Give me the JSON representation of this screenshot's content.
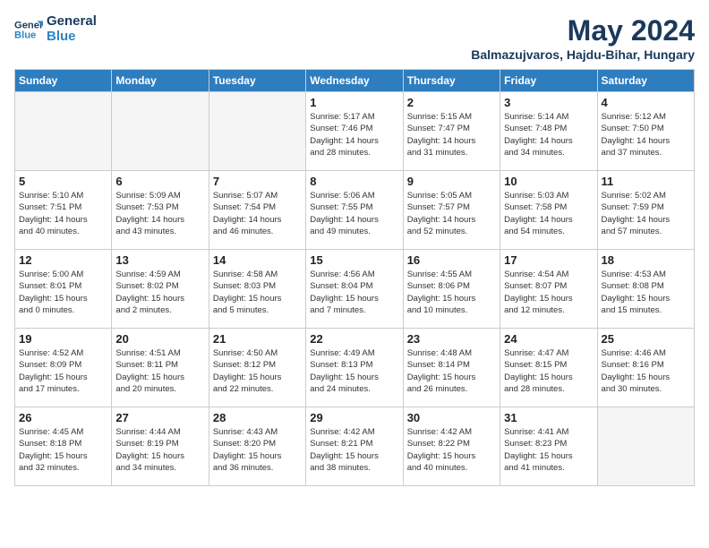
{
  "header": {
    "logo_line1": "General",
    "logo_line2": "Blue",
    "month_title": "May 2024",
    "subtitle": "Balmazujvaros, Hajdu-Bihar, Hungary"
  },
  "days_of_week": [
    "Sunday",
    "Monday",
    "Tuesday",
    "Wednesday",
    "Thursday",
    "Friday",
    "Saturday"
  ],
  "weeks": [
    [
      {
        "day": "",
        "info": ""
      },
      {
        "day": "",
        "info": ""
      },
      {
        "day": "",
        "info": ""
      },
      {
        "day": "1",
        "info": "Sunrise: 5:17 AM\nSunset: 7:46 PM\nDaylight: 14 hours\nand 28 minutes."
      },
      {
        "day": "2",
        "info": "Sunrise: 5:15 AM\nSunset: 7:47 PM\nDaylight: 14 hours\nand 31 minutes."
      },
      {
        "day": "3",
        "info": "Sunrise: 5:14 AM\nSunset: 7:48 PM\nDaylight: 14 hours\nand 34 minutes."
      },
      {
        "day": "4",
        "info": "Sunrise: 5:12 AM\nSunset: 7:50 PM\nDaylight: 14 hours\nand 37 minutes."
      }
    ],
    [
      {
        "day": "5",
        "info": "Sunrise: 5:10 AM\nSunset: 7:51 PM\nDaylight: 14 hours\nand 40 minutes."
      },
      {
        "day": "6",
        "info": "Sunrise: 5:09 AM\nSunset: 7:53 PM\nDaylight: 14 hours\nand 43 minutes."
      },
      {
        "day": "7",
        "info": "Sunrise: 5:07 AM\nSunset: 7:54 PM\nDaylight: 14 hours\nand 46 minutes."
      },
      {
        "day": "8",
        "info": "Sunrise: 5:06 AM\nSunset: 7:55 PM\nDaylight: 14 hours\nand 49 minutes."
      },
      {
        "day": "9",
        "info": "Sunrise: 5:05 AM\nSunset: 7:57 PM\nDaylight: 14 hours\nand 52 minutes."
      },
      {
        "day": "10",
        "info": "Sunrise: 5:03 AM\nSunset: 7:58 PM\nDaylight: 14 hours\nand 54 minutes."
      },
      {
        "day": "11",
        "info": "Sunrise: 5:02 AM\nSunset: 7:59 PM\nDaylight: 14 hours\nand 57 minutes."
      }
    ],
    [
      {
        "day": "12",
        "info": "Sunrise: 5:00 AM\nSunset: 8:01 PM\nDaylight: 15 hours\nand 0 minutes."
      },
      {
        "day": "13",
        "info": "Sunrise: 4:59 AM\nSunset: 8:02 PM\nDaylight: 15 hours\nand 2 minutes."
      },
      {
        "day": "14",
        "info": "Sunrise: 4:58 AM\nSunset: 8:03 PM\nDaylight: 15 hours\nand 5 minutes."
      },
      {
        "day": "15",
        "info": "Sunrise: 4:56 AM\nSunset: 8:04 PM\nDaylight: 15 hours\nand 7 minutes."
      },
      {
        "day": "16",
        "info": "Sunrise: 4:55 AM\nSunset: 8:06 PM\nDaylight: 15 hours\nand 10 minutes."
      },
      {
        "day": "17",
        "info": "Sunrise: 4:54 AM\nSunset: 8:07 PM\nDaylight: 15 hours\nand 12 minutes."
      },
      {
        "day": "18",
        "info": "Sunrise: 4:53 AM\nSunset: 8:08 PM\nDaylight: 15 hours\nand 15 minutes."
      }
    ],
    [
      {
        "day": "19",
        "info": "Sunrise: 4:52 AM\nSunset: 8:09 PM\nDaylight: 15 hours\nand 17 minutes."
      },
      {
        "day": "20",
        "info": "Sunrise: 4:51 AM\nSunset: 8:11 PM\nDaylight: 15 hours\nand 20 minutes."
      },
      {
        "day": "21",
        "info": "Sunrise: 4:50 AM\nSunset: 8:12 PM\nDaylight: 15 hours\nand 22 minutes."
      },
      {
        "day": "22",
        "info": "Sunrise: 4:49 AM\nSunset: 8:13 PM\nDaylight: 15 hours\nand 24 minutes."
      },
      {
        "day": "23",
        "info": "Sunrise: 4:48 AM\nSunset: 8:14 PM\nDaylight: 15 hours\nand 26 minutes."
      },
      {
        "day": "24",
        "info": "Sunrise: 4:47 AM\nSunset: 8:15 PM\nDaylight: 15 hours\nand 28 minutes."
      },
      {
        "day": "25",
        "info": "Sunrise: 4:46 AM\nSunset: 8:16 PM\nDaylight: 15 hours\nand 30 minutes."
      }
    ],
    [
      {
        "day": "26",
        "info": "Sunrise: 4:45 AM\nSunset: 8:18 PM\nDaylight: 15 hours\nand 32 minutes."
      },
      {
        "day": "27",
        "info": "Sunrise: 4:44 AM\nSunset: 8:19 PM\nDaylight: 15 hours\nand 34 minutes."
      },
      {
        "day": "28",
        "info": "Sunrise: 4:43 AM\nSunset: 8:20 PM\nDaylight: 15 hours\nand 36 minutes."
      },
      {
        "day": "29",
        "info": "Sunrise: 4:42 AM\nSunset: 8:21 PM\nDaylight: 15 hours\nand 38 minutes."
      },
      {
        "day": "30",
        "info": "Sunrise: 4:42 AM\nSunset: 8:22 PM\nDaylight: 15 hours\nand 40 minutes."
      },
      {
        "day": "31",
        "info": "Sunrise: 4:41 AM\nSunset: 8:23 PM\nDaylight: 15 hours\nand 41 minutes."
      },
      {
        "day": "",
        "info": ""
      }
    ]
  ]
}
